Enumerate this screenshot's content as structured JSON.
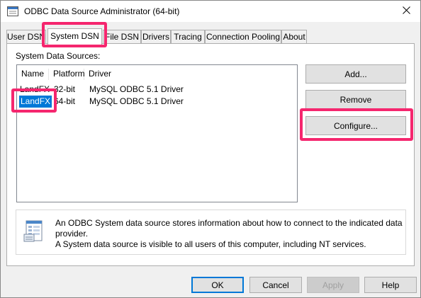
{
  "window": {
    "title": "ODBC Data Source Administrator (64-bit)",
    "close_glyph": "✕"
  },
  "tabs": [
    {
      "label": "User DSN",
      "active": false
    },
    {
      "label": "System DSN",
      "active": true
    },
    {
      "label": "File DSN",
      "active": false
    },
    {
      "label": "Drivers",
      "active": false
    },
    {
      "label": "Tracing",
      "active": false
    },
    {
      "label": "Connection Pooling",
      "active": false
    },
    {
      "label": "About",
      "active": false
    }
  ],
  "panel": {
    "group_label": "System Data Sources:",
    "columns": [
      "Name",
      "Platform",
      "Driver"
    ],
    "rows": [
      {
        "name": "LandFX",
        "platform": "32-bit",
        "driver": "MySQL ODBC 5.1 Driver",
        "selected": false
      },
      {
        "name": "LandFX",
        "platform": "64-bit",
        "driver": "MySQL ODBC 5.1 Driver",
        "selected": true
      }
    ],
    "buttons": {
      "add": "Add...",
      "remove": "Remove",
      "configure": "Configure..."
    },
    "info": {
      "icon": "data-source-icon",
      "line1": "An ODBC System data source stores information about how to connect to the indicated data provider.",
      "line2": "A System data source is visible to all users of this computer, including NT services."
    }
  },
  "footer": {
    "ok": "OK",
    "cancel": "Cancel",
    "apply": "Apply",
    "help": "Help"
  },
  "colors": {
    "highlight": "#f5266e",
    "selection": "#0078d7"
  }
}
